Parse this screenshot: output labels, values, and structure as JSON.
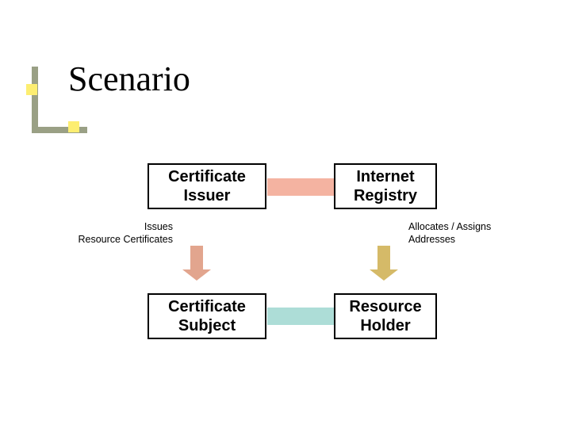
{
  "title": "Scenario",
  "boxes": {
    "cert_issuer": {
      "line1": "Certificate",
      "line2": "Issuer"
    },
    "internet_reg": {
      "line1": "Internet",
      "line2": "Registry"
    },
    "cert_subject": {
      "line1": "Certificate",
      "line2": "Subject"
    },
    "res_holder": {
      "line1": "Resource",
      "line2": "Holder"
    }
  },
  "annotations": {
    "left": {
      "line1": "Issues",
      "line2": "Resource Certificates"
    },
    "right": {
      "line1": "Allocates / Assigns",
      "line2": "Addresses"
    }
  },
  "colors": {
    "bar_top": "#f4b3a1",
    "bar_bottom": "#adddd7",
    "arrow_left": "#e2a58e",
    "arrow_right": "#d5ba68",
    "bullet_line": "#9aa085",
    "bullet_sq": "#fdee71"
  },
  "chart_data": {
    "type": "diagram",
    "nodes": [
      {
        "id": "cert_issuer",
        "label": "Certificate Issuer"
      },
      {
        "id": "internet_reg",
        "label": "Internet Registry"
      },
      {
        "id": "cert_subject",
        "label": "Certificate Subject"
      },
      {
        "id": "res_holder",
        "label": "Resource Holder"
      }
    ],
    "edges": [
      {
        "from": "cert_issuer",
        "to": "internet_reg",
        "style": "association",
        "color": "#f4b3a1"
      },
      {
        "from": "cert_subject",
        "to": "res_holder",
        "style": "association",
        "color": "#adddd7"
      },
      {
        "from": "cert_issuer",
        "to": "cert_subject",
        "style": "arrow-down",
        "label": "Issues Resource Certificates",
        "color": "#e2a58e"
      },
      {
        "from": "internet_reg",
        "to": "res_holder",
        "style": "arrow-down",
        "label": "Allocates / Assigns Addresses",
        "color": "#d5ba68"
      }
    ],
    "title": "Scenario"
  }
}
